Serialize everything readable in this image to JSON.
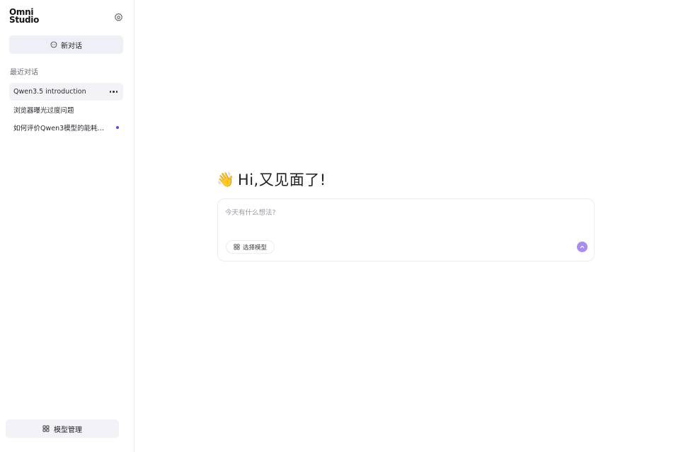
{
  "app": {
    "logo_line1": "Omni",
    "logo_line2": "Studio"
  },
  "sidebar": {
    "new_chat_label": "新对话",
    "recent_heading": "最近对话",
    "chats": [
      {
        "title": "Qwen3.5 introduction",
        "active": true
      },
      {
        "title": "浏览器曝光过度问题",
        "active": false
      },
      {
        "title": "如何评价Qwen3模型的能耗问...",
        "active": false,
        "unread": true
      }
    ],
    "model_manage_label": "模型管理"
  },
  "main": {
    "greeting_emoji": "👋",
    "greeting": "Hi,又见面了!",
    "composer_placeholder": "今天有什么想法?",
    "model_select_label": "选择模型"
  },
  "colors": {
    "accent": "#a98cf0",
    "unread_dot": "#5b4be0",
    "button_bg": "#efeff7"
  }
}
